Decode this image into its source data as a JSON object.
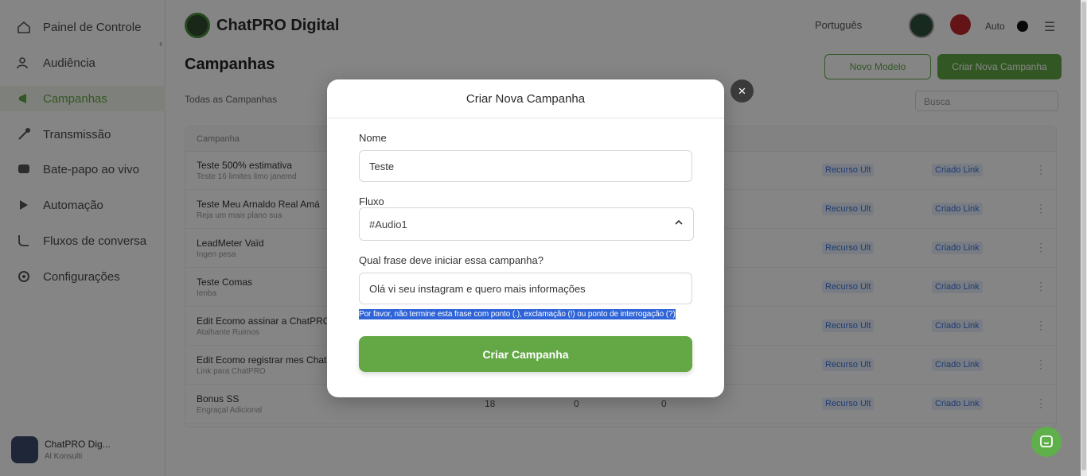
{
  "sidebar": {
    "items": [
      {
        "label": "Painel de Controle",
        "icon": "dashboard-icon"
      },
      {
        "label": "Audiência",
        "icon": "users-icon"
      },
      {
        "label": "Campanhas",
        "icon": "megaphone-icon",
        "active": true
      },
      {
        "label": "Transmissão",
        "icon": "broadcast-icon"
      },
      {
        "label": "Bate-papo ao vivo",
        "icon": "chat-icon"
      },
      {
        "label": "Automação",
        "icon": "automation-icon"
      },
      {
        "label": "Fluxos de conversa",
        "icon": "flow-icon"
      },
      {
        "label": "Configurações",
        "icon": "gear-icon"
      }
    ],
    "footer": {
      "name": "ChatPRO Dig...",
      "sub": "Al Konsulti"
    }
  },
  "topbar": {
    "brand": "ChatPRO Digital",
    "language": "Português",
    "user": "Auto"
  },
  "page": {
    "title": "Campanhas",
    "outline_button": "Novo Modelo",
    "primary_button": "Criar Nova Campanha",
    "filter": "Todas as Campanhas",
    "search_placeholder": "Busca",
    "table_header": "Campanha",
    "rows": [
      {
        "name": "Teste 500% estimativa",
        "sub": "Teste 16 limites limo janemd",
        "n1": "",
        "n2": "",
        "n3": ""
      },
      {
        "name": "Teste Meu Arnaldo Real Amá",
        "sub": "Reja um mais plano sua",
        "n1": "",
        "n2": "",
        "n3": ""
      },
      {
        "name": "LeadMeter Vaïd",
        "sub": "Ingen pesa",
        "n1": "",
        "n2": "",
        "n3": ""
      },
      {
        "name": "Teste Comas",
        "sub": "Ienba",
        "n1": "",
        "n2": "",
        "n3": ""
      },
      {
        "name": "Edit Ecomo assinar a ChatPRO",
        "sub": "Atalhante Ruimos",
        "n1": "",
        "n2": "",
        "n3": ""
      },
      {
        "name": "Edit Ecomo registrar mes ChatPRO",
        "sub": "Link para ChatPRO",
        "n1": "",
        "n2": "",
        "n3": ""
      },
      {
        "name": "Bonus SS",
        "sub": "Engraçal Adicional",
        "n1": "18",
        "n2": "0",
        "n3": "0"
      }
    ],
    "link1": "Recurso Ult",
    "link2": "Criado Link"
  },
  "modal": {
    "title": "Criar Nova Campanha",
    "close_label": "×",
    "name_label": "Nome",
    "name_value": "Teste",
    "flow_label": "Fluxo",
    "flow_value": "#Audio1",
    "phrase_label": "Qual frase deve iniciar essa campanha?",
    "phrase_value": "Olá vi seu instagram e quero mais informações",
    "hint": "Por favor, não termine esta frase com ponto (.), exclamação (!) ou ponto de interrogação (?)",
    "submit_label": "Criar Campanha"
  },
  "colors": {
    "accent": "#63a845",
    "overlay": "rgba(0,0,0,0.48)",
    "selection": "#2e64d8"
  }
}
